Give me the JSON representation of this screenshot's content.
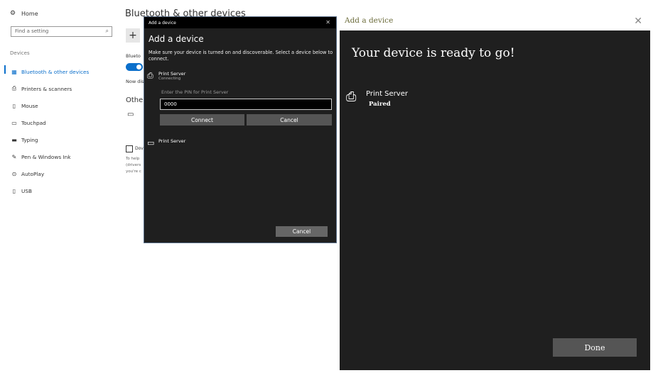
{
  "settings": {
    "home_label": "Home",
    "search_placeholder": "Find a setting",
    "section_label": "Devices",
    "items": [
      {
        "label": "Bluetooth & other devices",
        "icon": "bluetooth-icon"
      },
      {
        "label": "Printers & scanners",
        "icon": "printer-icon"
      },
      {
        "label": "Mouse",
        "icon": "mouse-icon"
      },
      {
        "label": "Touchpad",
        "icon": "touchpad-icon"
      },
      {
        "label": "Typing",
        "icon": "keyboard-icon"
      },
      {
        "label": "Pen & Windows Ink",
        "icon": "pen-icon"
      },
      {
        "label": "AutoPlay",
        "icon": "autoplay-icon"
      },
      {
        "label": "USB",
        "icon": "usb-icon"
      }
    ],
    "page_title": "Bluetooth & other devices",
    "add_symbol": "+",
    "bluetooth_label": "Blueto",
    "now_discoverable": "Now dis",
    "other_devices": "Other",
    "checkbox_text": "Dov",
    "help_lines": [
      "To help",
      "(drivers",
      "you're c"
    ]
  },
  "small_dialog": {
    "title": "Add a device",
    "close_symbol": "✕",
    "heading": "Add a device",
    "instructions": "Make sure your device is turned on and discoverable. Select a device below to connect.",
    "device1_name": "Print Server",
    "device1_status": "Connecting",
    "pin_label": "Enter the PIN for Print Server",
    "pin_value": "0000",
    "connect_label": "Connect",
    "cancel_pin_label": "Cancel",
    "device2_name": "Print Server",
    "cancel_label": "Cancel"
  },
  "large_dialog": {
    "title": "Add a device",
    "close_symbol": "✕",
    "heading": "Your device is ready to go!",
    "device_name": "Print Server",
    "device_status": "Paired",
    "done_label": "Done"
  },
  "colors": {
    "accent": "#0b6fcb",
    "dialog_bg": "#1f1f1f",
    "button_bg": "#555555"
  }
}
